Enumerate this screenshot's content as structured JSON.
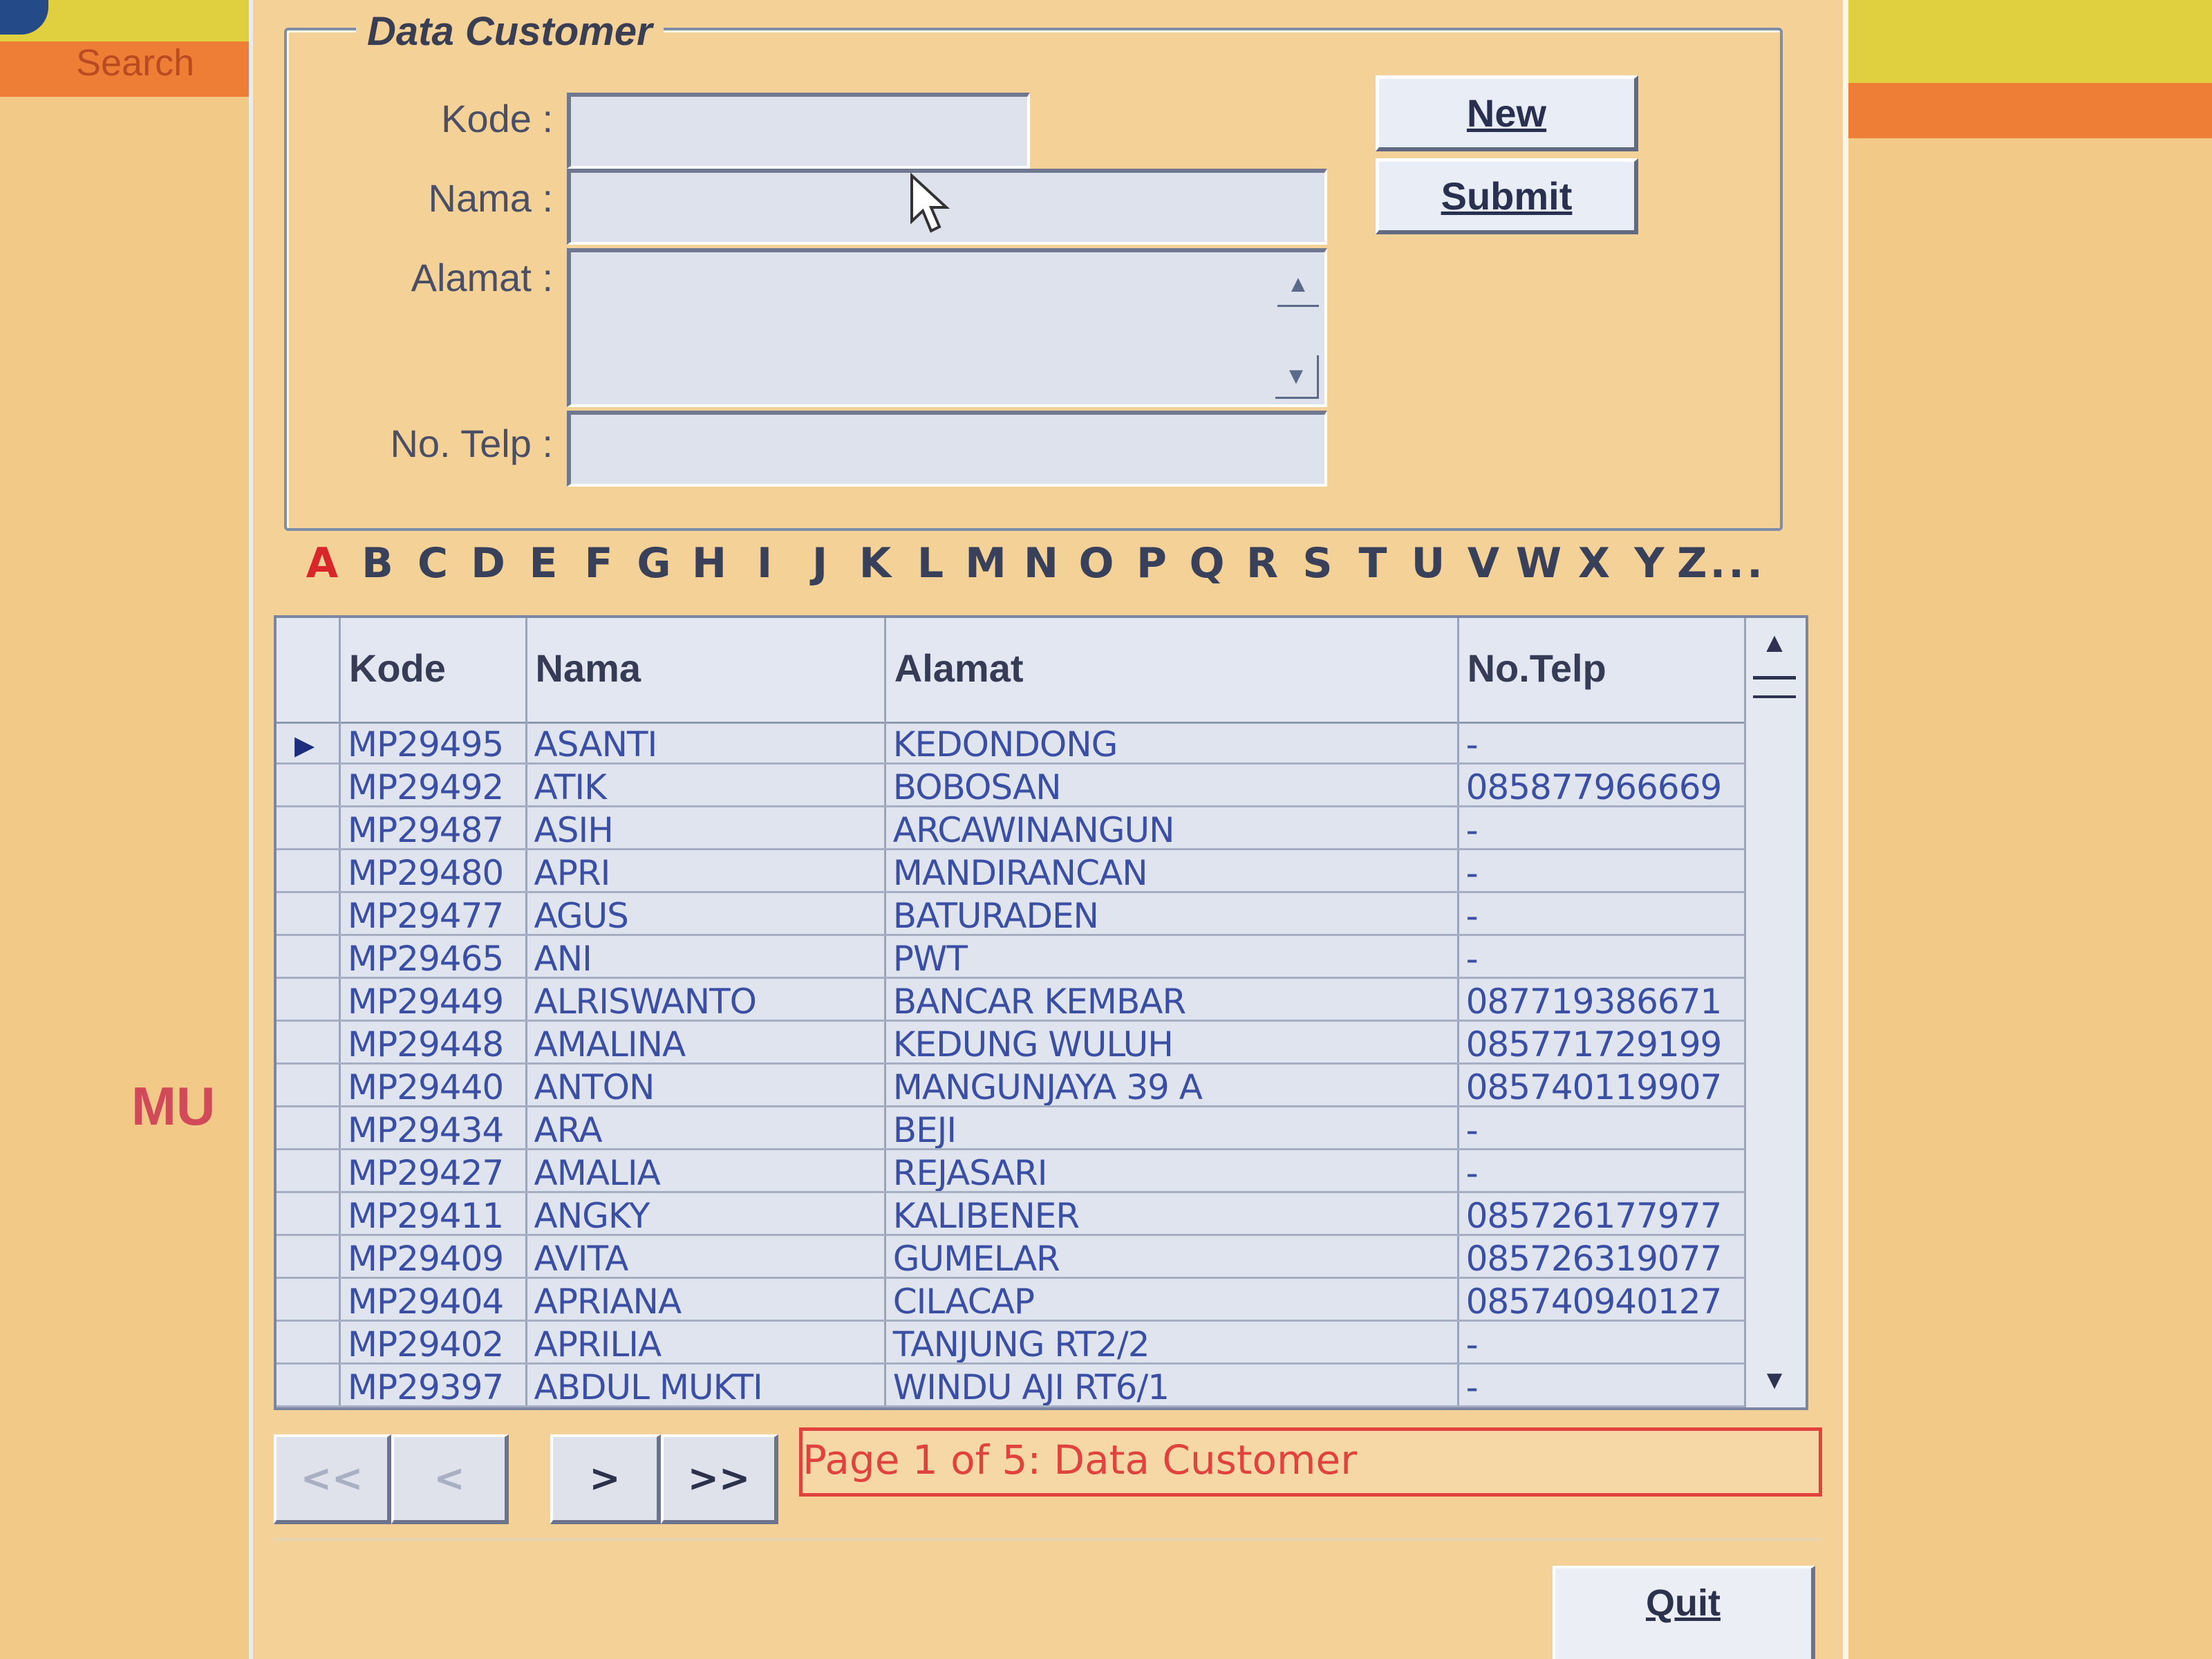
{
  "background": {
    "search_label": "Search",
    "brand_fragment": "MU"
  },
  "form": {
    "title": "Data Customer",
    "labels": {
      "kode": "Kode :",
      "nama": "Nama :",
      "alamat": "Alamat :",
      "telp": "No. Telp :"
    },
    "values": {
      "kode": "",
      "nama": "",
      "alamat": "",
      "telp": ""
    },
    "buttons": {
      "new": "New",
      "submit": "Submit"
    }
  },
  "alphabet": {
    "letters": [
      "A",
      "B",
      "C",
      "D",
      "E",
      "F",
      "G",
      "H",
      "I",
      "J",
      "K",
      "L",
      "M",
      "N",
      "O",
      "P",
      "Q",
      "R",
      "S",
      "T",
      "U",
      "V",
      "W",
      "X",
      "Y",
      "Z..."
    ],
    "active": "A"
  },
  "grid": {
    "columns": [
      "Kode",
      "Nama",
      "Alamat",
      "No.Telp"
    ],
    "rows": [
      [
        "MP29495",
        "ASANTI",
        "KEDONDONG",
        "-"
      ],
      [
        "MP29492",
        "ATIK",
        "BOBOSAN",
        "085877966669"
      ],
      [
        "MP29487",
        "ASIH",
        "ARCAWINANGUN",
        "-"
      ],
      [
        "MP29480",
        "APRI",
        "MANDIRANCAN",
        "-"
      ],
      [
        "MP29477",
        "AGUS",
        "BATURADEN",
        "-"
      ],
      [
        "MP29465",
        "ANI",
        "PWT",
        "-"
      ],
      [
        "MP29449",
        "ALRISWANTO",
        "BANCAR KEMBAR",
        "087719386671"
      ],
      [
        "MP29448",
        "AMALINA",
        "KEDUNG WULUH",
        "085771729199"
      ],
      [
        "MP29440",
        "ANTON",
        "MANGUNJAYA 39 A",
        "085740119907"
      ],
      [
        "MP29434",
        "ARA",
        "BEJI",
        "-"
      ],
      [
        "MP29427",
        "AMALIA",
        "REJASARI",
        "-"
      ],
      [
        "MP29411",
        "ANGKY",
        "KALIBENER",
        "085726177977"
      ],
      [
        "MP29409",
        "AVITA",
        "GUMELAR",
        "085726319077"
      ],
      [
        "MP29404",
        "APRIANA",
        "CILACAP",
        "085740940127"
      ],
      [
        "MP29402",
        "APRILIA",
        "TANJUNG RT2/2",
        "-"
      ],
      [
        "MP29397",
        "ABDUL MUKTI",
        "WINDU AJI RT6/1",
        "-"
      ]
    ]
  },
  "pager": {
    "first": "<<",
    "prev": "<",
    "next": ">",
    "last": ">>",
    "info": "Page 1 of 5: Data Customer"
  },
  "quit_label": "Quit",
  "colors": {
    "accent_red": "#e0433e",
    "grid_text": "#3a4ea4",
    "panel": "#f4d197"
  }
}
